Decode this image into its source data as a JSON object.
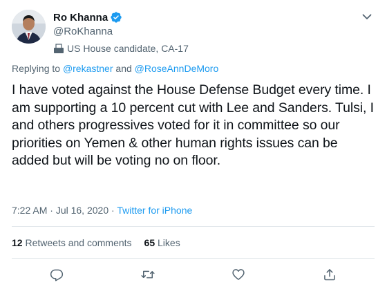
{
  "author": {
    "display_name": "Ro Khanna",
    "handle": "@RoKhanna",
    "label": "US House candidate, CA-17",
    "avatar_icon": "avatar-photo",
    "verified_icon": "verified-badge-icon",
    "label_icon": "ballot-box-icon"
  },
  "reply": {
    "prefix": "Replying to",
    "mention_1": "@rekastner",
    "conjunction": "and",
    "mention_2": "@RoseAnnDeMoro"
  },
  "tweet": {
    "text": "I have voted against the House Defense Budget every time. I am supporting a 10 percent cut with Lee and Sanders. Tulsi, I and others progressives voted for it in committee so our priorities on Yemen & other human rights issues can be added but will be voting no on floor."
  },
  "meta": {
    "time": "7:22 AM",
    "separator_1": "·",
    "date": "Jul 16, 2020",
    "separator_2": "·",
    "source": "Twitter for iPhone"
  },
  "stats": {
    "retweets_count": "12",
    "retweets_label": "Retweets and comments",
    "likes_count": "65",
    "likes_label": "Likes"
  },
  "actions": [
    "reply-icon",
    "retweet-icon",
    "like-icon",
    "share-icon"
  ],
  "colors": {
    "accent": "#1d9bf0",
    "secondary_text": "#536471",
    "primary_text": "#0f1419",
    "divider": "#e3e8ec"
  }
}
